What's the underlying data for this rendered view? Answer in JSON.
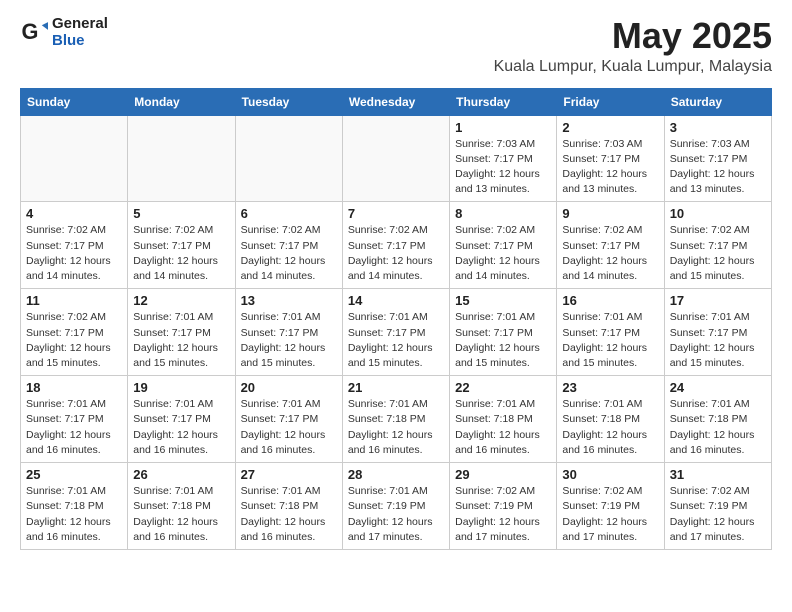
{
  "logo": {
    "general": "General",
    "blue": "Blue"
  },
  "header": {
    "title": "May 2025",
    "subtitle": "Kuala Lumpur, Kuala Lumpur, Malaysia"
  },
  "weekdays": [
    "Sunday",
    "Monday",
    "Tuesday",
    "Wednesday",
    "Thursday",
    "Friday",
    "Saturday"
  ],
  "weeks": [
    [
      {
        "day": "",
        "info": ""
      },
      {
        "day": "",
        "info": ""
      },
      {
        "day": "",
        "info": ""
      },
      {
        "day": "",
        "info": ""
      },
      {
        "day": "1",
        "info": "Sunrise: 7:03 AM\nSunset: 7:17 PM\nDaylight: 12 hours\nand 13 minutes."
      },
      {
        "day": "2",
        "info": "Sunrise: 7:03 AM\nSunset: 7:17 PM\nDaylight: 12 hours\nand 13 minutes."
      },
      {
        "day": "3",
        "info": "Sunrise: 7:03 AM\nSunset: 7:17 PM\nDaylight: 12 hours\nand 13 minutes."
      }
    ],
    [
      {
        "day": "4",
        "info": "Sunrise: 7:02 AM\nSunset: 7:17 PM\nDaylight: 12 hours\nand 14 minutes."
      },
      {
        "day": "5",
        "info": "Sunrise: 7:02 AM\nSunset: 7:17 PM\nDaylight: 12 hours\nand 14 minutes."
      },
      {
        "day": "6",
        "info": "Sunrise: 7:02 AM\nSunset: 7:17 PM\nDaylight: 12 hours\nand 14 minutes."
      },
      {
        "day": "7",
        "info": "Sunrise: 7:02 AM\nSunset: 7:17 PM\nDaylight: 12 hours\nand 14 minutes."
      },
      {
        "day": "8",
        "info": "Sunrise: 7:02 AM\nSunset: 7:17 PM\nDaylight: 12 hours\nand 14 minutes."
      },
      {
        "day": "9",
        "info": "Sunrise: 7:02 AM\nSunset: 7:17 PM\nDaylight: 12 hours\nand 14 minutes."
      },
      {
        "day": "10",
        "info": "Sunrise: 7:02 AM\nSunset: 7:17 PM\nDaylight: 12 hours\nand 15 minutes."
      }
    ],
    [
      {
        "day": "11",
        "info": "Sunrise: 7:02 AM\nSunset: 7:17 PM\nDaylight: 12 hours\nand 15 minutes."
      },
      {
        "day": "12",
        "info": "Sunrise: 7:01 AM\nSunset: 7:17 PM\nDaylight: 12 hours\nand 15 minutes."
      },
      {
        "day": "13",
        "info": "Sunrise: 7:01 AM\nSunset: 7:17 PM\nDaylight: 12 hours\nand 15 minutes."
      },
      {
        "day": "14",
        "info": "Sunrise: 7:01 AM\nSunset: 7:17 PM\nDaylight: 12 hours\nand 15 minutes."
      },
      {
        "day": "15",
        "info": "Sunrise: 7:01 AM\nSunset: 7:17 PM\nDaylight: 12 hours\nand 15 minutes."
      },
      {
        "day": "16",
        "info": "Sunrise: 7:01 AM\nSunset: 7:17 PM\nDaylight: 12 hours\nand 15 minutes."
      },
      {
        "day": "17",
        "info": "Sunrise: 7:01 AM\nSunset: 7:17 PM\nDaylight: 12 hours\nand 15 minutes."
      }
    ],
    [
      {
        "day": "18",
        "info": "Sunrise: 7:01 AM\nSunset: 7:17 PM\nDaylight: 12 hours\nand 16 minutes."
      },
      {
        "day": "19",
        "info": "Sunrise: 7:01 AM\nSunset: 7:17 PM\nDaylight: 12 hours\nand 16 minutes."
      },
      {
        "day": "20",
        "info": "Sunrise: 7:01 AM\nSunset: 7:17 PM\nDaylight: 12 hours\nand 16 minutes."
      },
      {
        "day": "21",
        "info": "Sunrise: 7:01 AM\nSunset: 7:18 PM\nDaylight: 12 hours\nand 16 minutes."
      },
      {
        "day": "22",
        "info": "Sunrise: 7:01 AM\nSunset: 7:18 PM\nDaylight: 12 hours\nand 16 minutes."
      },
      {
        "day": "23",
        "info": "Sunrise: 7:01 AM\nSunset: 7:18 PM\nDaylight: 12 hours\nand 16 minutes."
      },
      {
        "day": "24",
        "info": "Sunrise: 7:01 AM\nSunset: 7:18 PM\nDaylight: 12 hours\nand 16 minutes."
      }
    ],
    [
      {
        "day": "25",
        "info": "Sunrise: 7:01 AM\nSunset: 7:18 PM\nDaylight: 12 hours\nand 16 minutes."
      },
      {
        "day": "26",
        "info": "Sunrise: 7:01 AM\nSunset: 7:18 PM\nDaylight: 12 hours\nand 16 minutes."
      },
      {
        "day": "27",
        "info": "Sunrise: 7:01 AM\nSunset: 7:18 PM\nDaylight: 12 hours\nand 16 minutes."
      },
      {
        "day": "28",
        "info": "Sunrise: 7:01 AM\nSunset: 7:19 PM\nDaylight: 12 hours\nand 17 minutes."
      },
      {
        "day": "29",
        "info": "Sunrise: 7:02 AM\nSunset: 7:19 PM\nDaylight: 12 hours\nand 17 minutes."
      },
      {
        "day": "30",
        "info": "Sunrise: 7:02 AM\nSunset: 7:19 PM\nDaylight: 12 hours\nand 17 minutes."
      },
      {
        "day": "31",
        "info": "Sunrise: 7:02 AM\nSunset: 7:19 PM\nDaylight: 12 hours\nand 17 minutes."
      }
    ]
  ]
}
